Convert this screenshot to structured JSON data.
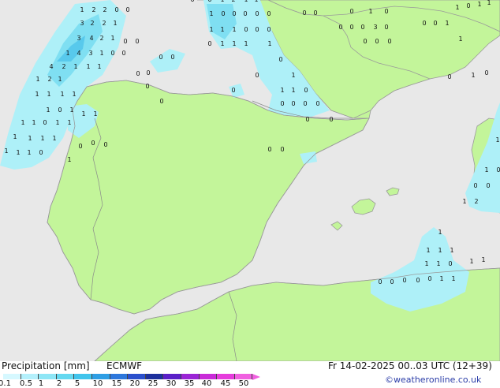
{
  "footer": {
    "title": "Precipitation [mm]",
    "model": "ECMWF",
    "valid_time": "Fr 14-02-2025 00..03 UTC (12+39)",
    "credit": "©weatheronline.co.uk"
  },
  "legend": {
    "ticks": [
      "0.1",
      "0.5",
      "1",
      "2",
      "5",
      "10",
      "15",
      "20",
      "25",
      "30",
      "35",
      "40",
      "45",
      "50"
    ],
    "colors": [
      "#d6f8ff",
      "#b4f0fc",
      "#8ee6f6",
      "#64d8f0",
      "#40c4ec",
      "#2e9ee4",
      "#2d77dc",
      "#2a4fcc",
      "#1c2f9c",
      "#5a1fc8",
      "#9b24d6",
      "#c92bd8",
      "#e63cdc",
      "#f060e0"
    ]
  },
  "map": {
    "colors": {
      "sea": "#e8e8e8",
      "land": "#c3f59a",
      "coast": "#9a9a9a",
      "rain_light": "#aef0f8",
      "rain_mid": "#7fdff2",
      "rain_heavy": "#58c9ec"
    },
    "point_values": [
      "1",
      "2",
      "2",
      "0",
      "0",
      "3",
      "2",
      "2",
      "1",
      "3",
      "4",
      "2",
      "1",
      "0",
      "0",
      "1",
      "4",
      "3",
      "1",
      "0",
      "0",
      "4",
      "2",
      "1",
      "1",
      "1",
      "1",
      "2",
      "1",
      "1",
      "1",
      "1",
      "1",
      "1",
      "0",
      "1",
      "1",
      "1",
      "1",
      "1",
      "0",
      "1",
      "1",
      "1",
      "1",
      "1",
      "1",
      "1",
      "1",
      "1",
      "0",
      "0",
      "0",
      "0",
      "1",
      "0",
      "0",
      "0",
      "0",
      "0",
      "0",
      "0",
      "0",
      "1",
      "2",
      "1",
      "1",
      "1",
      "0",
      "0",
      "0",
      "0",
      "0",
      "1",
      "1",
      "1",
      "0",
      "0",
      "0",
      "0",
      "1",
      "1",
      "1",
      "1",
      "0",
      "0",
      "1",
      "1",
      "1",
      "0",
      "0",
      "0",
      "0",
      "0",
      "0",
      "0",
      "0",
      "0",
      "0",
      "0",
      "0",
      "0",
      "0",
      "0",
      "3",
      "0",
      "1",
      "0",
      "0",
      "0",
      "0",
      "0",
      "0",
      "0",
      "1",
      "1",
      "0",
      "1",
      "1",
      "1",
      "0",
      "1",
      "0",
      "1",
      "1",
      "0",
      "0",
      "0",
      "1",
      "2",
      "1",
      "1",
      "1",
      "1",
      "1",
      "1",
      "0",
      "1",
      "1",
      "0",
      "0",
      "0",
      "0",
      "0",
      "1",
      "1"
    ]
  }
}
